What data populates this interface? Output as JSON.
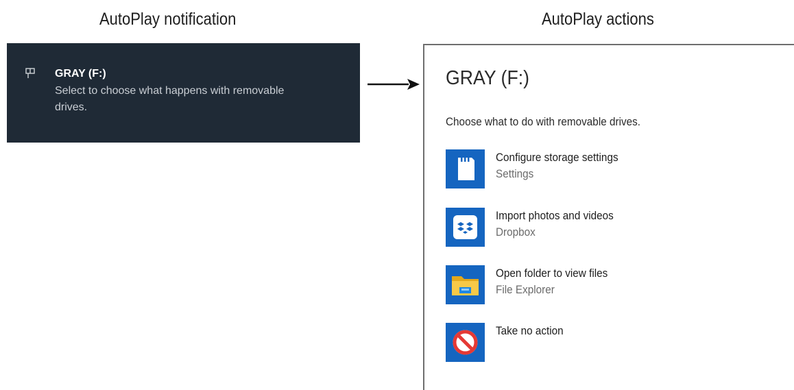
{
  "captions": {
    "notification": "AutoPlay notification",
    "actions": "AutoPlay actions"
  },
  "notification": {
    "icon": "drive-icon",
    "title": "GRAY (F:)",
    "body": "Select to choose what happens with removable drives.",
    "background_color": "#1f2a36"
  },
  "panel": {
    "title": "GRAY (F:)",
    "subtitle": "Choose what to do with removable drives.",
    "actions": [
      {
        "icon": "sd-card-icon",
        "label": "Configure storage settings",
        "app": "Settings"
      },
      {
        "icon": "dropbox-icon",
        "label": "Import photos and videos",
        "app": "Dropbox"
      },
      {
        "icon": "folder-icon",
        "label": "Open folder to view files",
        "app": "File Explorer"
      },
      {
        "icon": "no-action-icon",
        "label": "Take no action",
        "app": ""
      }
    ],
    "accent_color": "#1565c0"
  }
}
